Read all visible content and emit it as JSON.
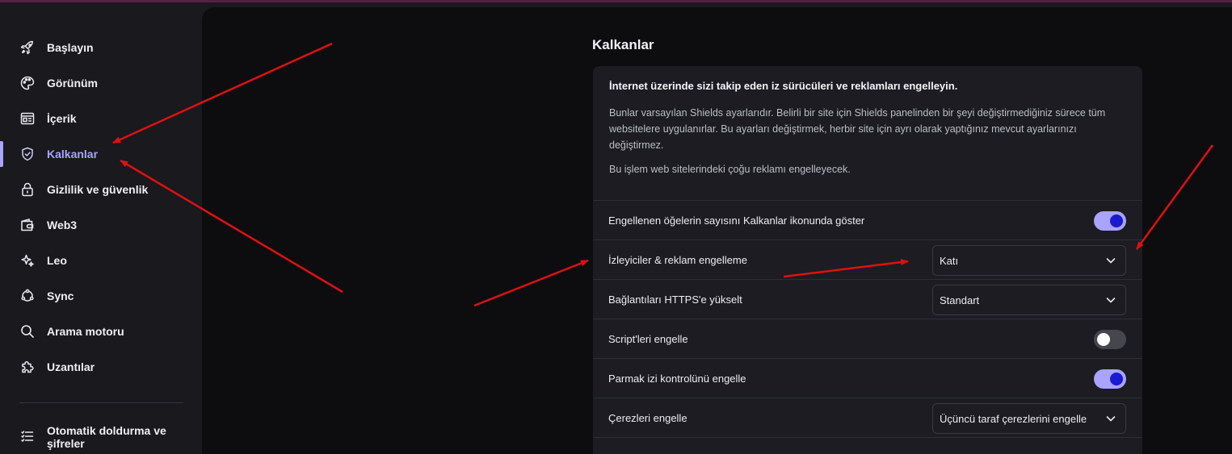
{
  "sidebar": {
    "items": [
      {
        "label": "Başlayın",
        "icon": "rocket-icon"
      },
      {
        "label": "Görünüm",
        "icon": "palette-icon"
      },
      {
        "label": "İçerik",
        "icon": "content-icon"
      },
      {
        "label": "Kalkanlar",
        "icon": "shield-icon",
        "active": true
      },
      {
        "label": "Gizlilik ve güvenlik",
        "icon": "lock-icon"
      },
      {
        "label": "Web3",
        "icon": "wallet-icon"
      },
      {
        "label": "Leo",
        "icon": "sparkle-icon"
      },
      {
        "label": "Sync",
        "icon": "sync-icon"
      },
      {
        "label": "Arama motoru",
        "icon": "search-icon"
      },
      {
        "label": "Uzantılar",
        "icon": "puzzle-icon"
      }
    ],
    "autofill": {
      "label_line1": "Otomatik doldurma ve",
      "label_line2": "şifreler",
      "icon": "list-icon"
    }
  },
  "main": {
    "section_title": "Kalkanlar",
    "card": {
      "heading": "İnternet üzerinde sizi takip eden iz sürücüleri ve reklamları engelleyin.",
      "description": "Bunlar varsayılan Shields ayarlarıdır. Belirli bir site için Shields panelinden bir şeyi değiştirmediğiniz sürece tüm websitelere uygulanırlar. Bu ayarları değiştirmek, herbir site için ayrı olarak yaptığınız mevcut ayarlarınızı değiştirmez.",
      "note": "Bu işlem web sitelerindeki çoğu reklamı engelleyecek.",
      "rows": [
        {
          "label": "Engellenen öğelerin sayısını Kalkanlar ikonunda göster",
          "control": "toggle",
          "on": true
        },
        {
          "label": "İzleyiciler & reklam engelleme",
          "control": "select",
          "value": "Katı"
        },
        {
          "label": "Bağlantıları HTTPS'e yükselt",
          "control": "select",
          "value": "Standart"
        },
        {
          "label": "Script'leri engelle",
          "control": "toggle",
          "on": false
        },
        {
          "label": "Parmak izi kontrolünü engelle",
          "control": "toggle",
          "on": true
        },
        {
          "label": "Çerezleri engelle",
          "control": "select",
          "value": "Üçüncü taraf çerezlerini engelle"
        }
      ]
    }
  },
  "colors": {
    "accent": "#a8a4ff",
    "toggle_knob_on": "#1a1ad0",
    "annotation_arrow": "#e01010"
  }
}
